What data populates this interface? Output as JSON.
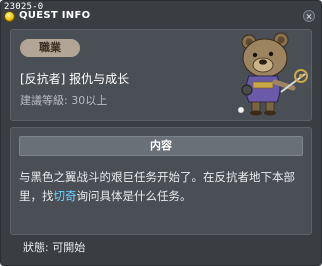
{
  "window": {
    "quest_id": "23025-0",
    "title": "QUEST INFO"
  },
  "quest": {
    "job_tag": "職業",
    "name": "[反抗者] 报仇与成长",
    "level": "建議等級: 30以上"
  },
  "content": {
    "header": "内容",
    "text_part1": "与黑色之翼战斗的艰巨任务开始了。在反抗者地下本部里，找",
    "npc_name": "切奇",
    "text_part2": "询问具体是什么任务。"
  },
  "status": {
    "text": "狀態:  可開始"
  },
  "colors": {
    "highlight": "#6bd5ff",
    "tag_bg": "#b3a596"
  }
}
